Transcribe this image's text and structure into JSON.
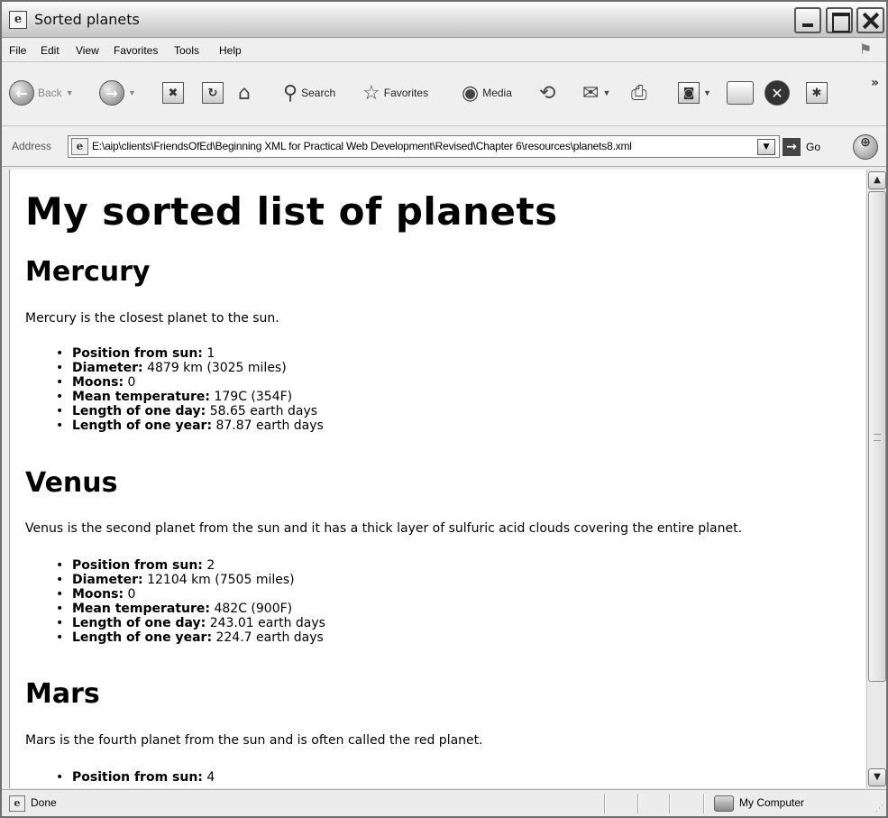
{
  "window": {
    "title": "Sorted planets",
    "icon": "ie-page-icon"
  },
  "menu": [
    "File",
    "Edit",
    "View",
    "Favorites",
    "Tools",
    "Help"
  ],
  "toolbar": {
    "back_label": "Back",
    "search_label": "Search",
    "favorites_label": "Favorites",
    "media_label": "Media",
    "overflow": "»"
  },
  "address": {
    "label": "Address",
    "url": "E:\\aip\\clients\\FriendsOfEd\\Beginning XML for Practical Web Development\\Revised\\Chapter 6\\resources\\planets8.xml",
    "go_label": "Go"
  },
  "page": {
    "heading": "My sorted list of planets",
    "planets": [
      {
        "name": "Mercury",
        "description": "Mercury is the closest planet to the sun.",
        "facts": [
          {
            "label": "Position from sun:",
            "value": " 1"
          },
          {
            "label": "Diameter:",
            "value": " 4879 km (3025 miles)"
          },
          {
            "label": "Moons:",
            "value": " 0"
          },
          {
            "label": "Mean temperature:",
            "value": " 179C (354F)"
          },
          {
            "label": "Length of one day:",
            "value": " 58.65 earth days"
          },
          {
            "label": "Length of one year:",
            "value": " 87.87 earth days"
          }
        ]
      },
      {
        "name": "Venus",
        "description": "Venus is the second planet from the sun and it has a thick layer of sulfuric acid clouds covering the entire planet.",
        "facts": [
          {
            "label": "Position from sun:",
            "value": " 2"
          },
          {
            "label": "Diameter:",
            "value": " 12104 km (7505 miles)"
          },
          {
            "label": "Moons:",
            "value": " 0"
          },
          {
            "label": "Mean temperature:",
            "value": " 482C (900F)"
          },
          {
            "label": "Length of one day:",
            "value": " 243.01 earth days"
          },
          {
            "label": "Length of one year:",
            "value": " 224.7 earth days"
          }
        ]
      },
      {
        "name": "Mars",
        "description": "Mars is the fourth planet from the sun and is often called the red planet.",
        "facts": [
          {
            "label": "Position from sun:",
            "value": " 4"
          }
        ]
      }
    ]
  },
  "status": {
    "text": "Done",
    "zone": "My Computer"
  }
}
